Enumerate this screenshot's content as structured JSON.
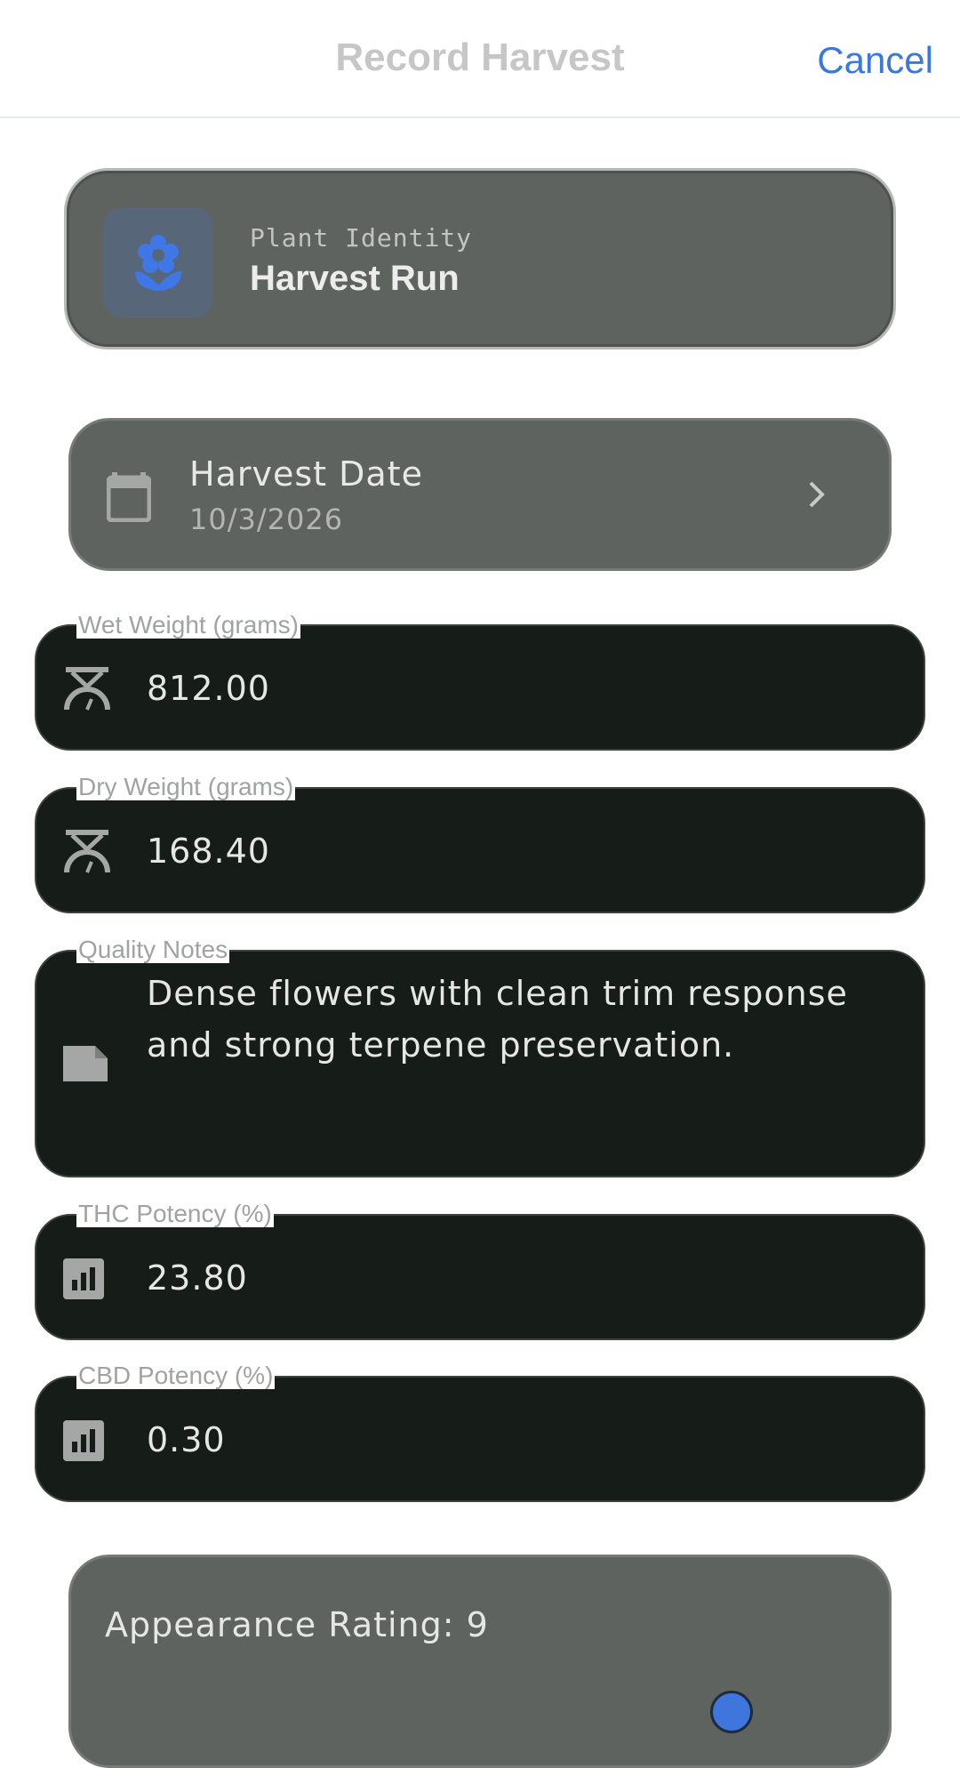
{
  "header": {
    "title": "Record Harvest",
    "cancel_label": "Cancel"
  },
  "plant": {
    "label": "Plant Identity",
    "name": "Harvest Run",
    "icon": "flower-icon"
  },
  "harvest_date": {
    "label": "Harvest Date",
    "value": "10/3/2026",
    "icon": "calendar-icon"
  },
  "fields": {
    "wet_weight": {
      "label": "Wet Weight (grams)",
      "value": "812.00",
      "icon": "scale-icon"
    },
    "dry_weight": {
      "label": "Dry Weight (grams)",
      "value": "168.40",
      "icon": "scale-icon"
    },
    "quality_notes": {
      "label": "Quality Notes",
      "value": "Dense flowers with clean trim response and strong terpene preservation.",
      "icon": "note-icon"
    },
    "thc": {
      "label": "THC Potency (%)",
      "value": "23.80",
      "icon": "chart-icon"
    },
    "cbd": {
      "label": "CBD Potency (%)",
      "value": "0.30",
      "icon": "chart-icon"
    }
  },
  "appearance": {
    "label": "Appearance Rating: 9",
    "rating": 9
  },
  "colors": {
    "accent": "#3a78e0",
    "field_bg": "#161c18",
    "card_bg": "#5f6360"
  }
}
